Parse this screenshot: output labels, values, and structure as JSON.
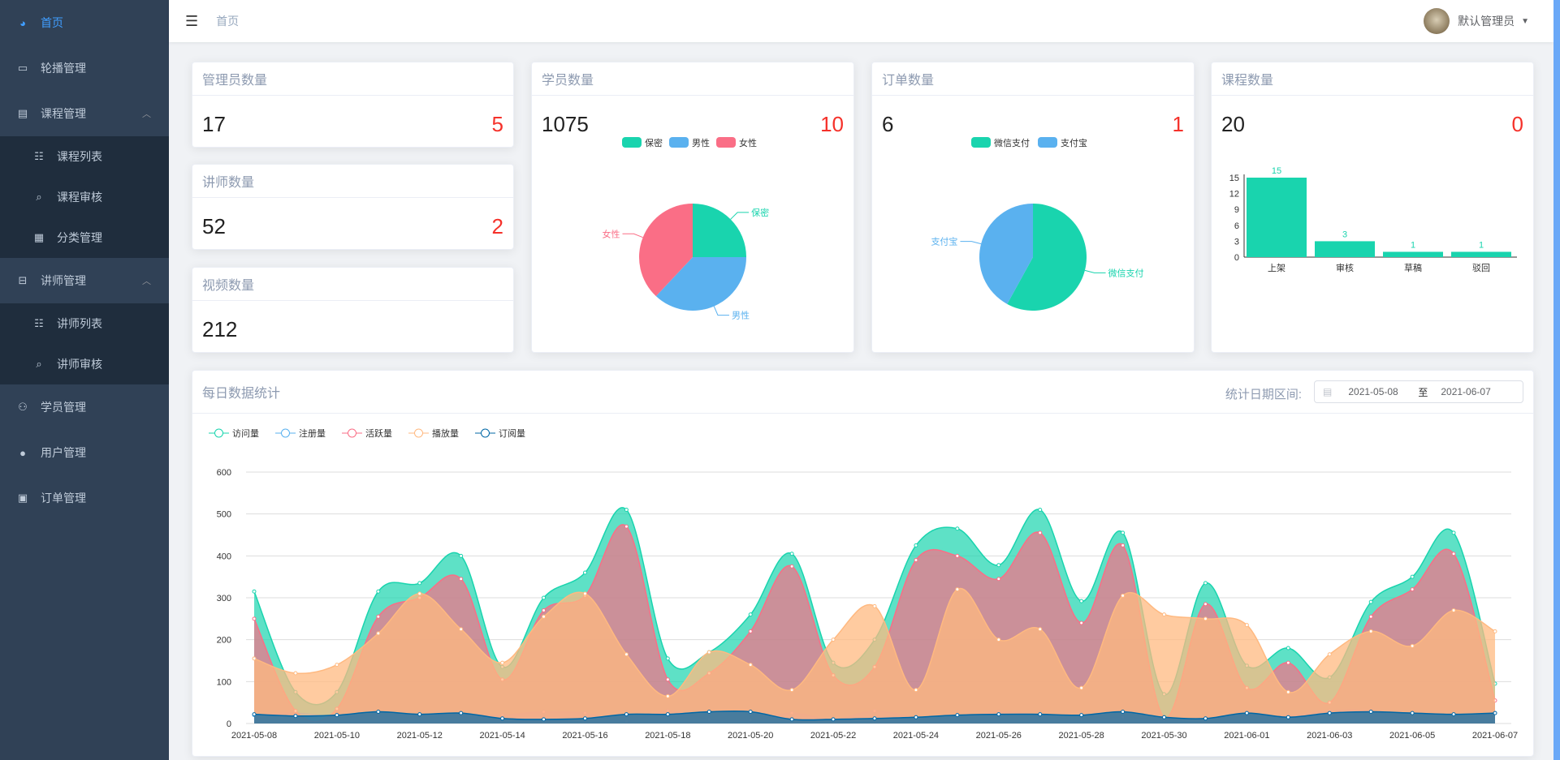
{
  "sidebar": {
    "items": [
      {
        "label": "首页",
        "icon": "dashboard-icon"
      },
      {
        "label": "轮播管理",
        "icon": "monitor-icon"
      },
      {
        "label": "课程管理",
        "icon": "book-icon"
      },
      {
        "label": "课程列表",
        "icon": "list-icon"
      },
      {
        "label": "课程审核",
        "icon": "review-icon"
      },
      {
        "label": "分类管理",
        "icon": "grid-icon"
      },
      {
        "label": "讲师管理",
        "icon": "teacher-icon"
      },
      {
        "label": "讲师列表",
        "icon": "list-icon"
      },
      {
        "label": "讲师审核",
        "icon": "review-icon"
      },
      {
        "label": "学员管理",
        "icon": "students-icon"
      },
      {
        "label": "用户管理",
        "icon": "user-icon"
      },
      {
        "label": "订单管理",
        "icon": "clipboard-icon"
      }
    ]
  },
  "header": {
    "breadcrumb": "首页",
    "username": "默认管理员"
  },
  "cards": {
    "admins": {
      "title": "管理员数量",
      "total": "17",
      "today": "5"
    },
    "teachers": {
      "title": "讲师数量",
      "total": "52",
      "today": "2"
    },
    "videos": {
      "title": "视频数量",
      "total": "212"
    },
    "students": {
      "title": "学员数量",
      "total": "1075",
      "today": "10"
    },
    "orders": {
      "title": "订单数量",
      "total": "6",
      "today": "1"
    },
    "courses": {
      "title": "课程数量",
      "total": "20",
      "today": "0"
    }
  },
  "daily": {
    "title": "每日数据统计",
    "range_label": "统计日期区间:",
    "start": "2021-05-08",
    "sep": "至",
    "end": "2021-06-07"
  },
  "chart_data": [
    {
      "type": "pie",
      "title": "学员数量",
      "labels": [
        "保密",
        "男性",
        "女性"
      ],
      "values": [
        25,
        37,
        38
      ],
      "colors": [
        "#19d4ae",
        "#5ab1ef",
        "#fa6e86"
      ]
    },
    {
      "type": "pie",
      "title": "订单数量",
      "labels": [
        "微信支付",
        "支付宝"
      ],
      "values": [
        58,
        42
      ],
      "colors": [
        "#19d4ae",
        "#5ab1ef"
      ]
    },
    {
      "type": "bar",
      "title": "课程数量",
      "categories": [
        "上架",
        "审核",
        "草稿",
        "驳回"
      ],
      "values": [
        15,
        3,
        1,
        1
      ],
      "yticks": [
        0,
        3,
        6,
        9,
        12,
        15
      ],
      "color": "#19d4ae"
    },
    {
      "type": "area",
      "title": "每日数据统计",
      "ylim": [
        0,
        600
      ],
      "yticks": [
        0,
        100,
        200,
        300,
        400,
        500,
        600
      ],
      "x": [
        "2021-05-08",
        "2021-05-09",
        "2021-05-10",
        "2021-05-11",
        "2021-05-12",
        "2021-05-13",
        "2021-05-14",
        "2021-05-15",
        "2021-05-16",
        "2021-05-17",
        "2021-05-18",
        "2021-05-19",
        "2021-05-20",
        "2021-05-21",
        "2021-05-22",
        "2021-05-23",
        "2021-05-24",
        "2021-05-25",
        "2021-05-26",
        "2021-05-27",
        "2021-05-28",
        "2021-05-29",
        "2021-05-30",
        "2021-05-31",
        "2021-06-01",
        "2021-06-02",
        "2021-06-03",
        "2021-06-04",
        "2021-06-05",
        "2021-06-06",
        "2021-06-07"
      ],
      "series": [
        {
          "name": "访问量",
          "color": "#19d4ae",
          "values": [
            315,
            75,
            75,
            315,
            335,
            400,
            135,
            300,
            360,
            510,
            155,
            170,
            260,
            405,
            145,
            200,
            425,
            465,
            378,
            510,
            292,
            455,
            70,
            335,
            138,
            180,
            110,
            290,
            350,
            455,
            95
          ]
        },
        {
          "name": "注册量",
          "color": "#5ab1ef",
          "values": [
            20,
            25,
            15,
            20,
            20,
            20,
            20,
            28,
            25,
            5,
            30,
            10,
            8,
            25,
            10,
            30,
            15,
            15,
            28,
            20,
            10,
            15,
            10,
            12,
            20,
            18,
            30,
            30,
            10,
            10,
            25
          ]
        },
        {
          "name": "活跃量",
          "color": "#fa6e86",
          "values": [
            250,
            30,
            35,
            255,
            300,
            345,
            105,
            270,
            305,
            470,
            105,
            120,
            220,
            375,
            115,
            135,
            390,
            400,
            345,
            455,
            240,
            425,
            15,
            285,
            85,
            145,
            50,
            255,
            320,
            405,
            55
          ]
        },
        {
          "name": "播放量",
          "color": "#ffb980",
          "values": [
            155,
            120,
            140,
            215,
            310,
            225,
            145,
            255,
            310,
            165,
            65,
            170,
            140,
            80,
            200,
            280,
            80,
            320,
            200,
            225,
            85,
            305,
            260,
            250,
            235,
            75,
            165,
            220,
            185,
            270,
            220
          ]
        },
        {
          "name": "订阅量",
          "color": "#0067a6",
          "values": [
            22,
            18,
            20,
            28,
            22,
            25,
            12,
            10,
            12,
            22,
            22,
            28,
            28,
            10,
            10,
            12,
            15,
            20,
            22,
            22,
            20,
            28,
            15,
            12,
            25,
            15,
            25,
            28,
            25,
            22,
            25
          ]
        }
      ],
      "legend": "top-left"
    }
  ]
}
